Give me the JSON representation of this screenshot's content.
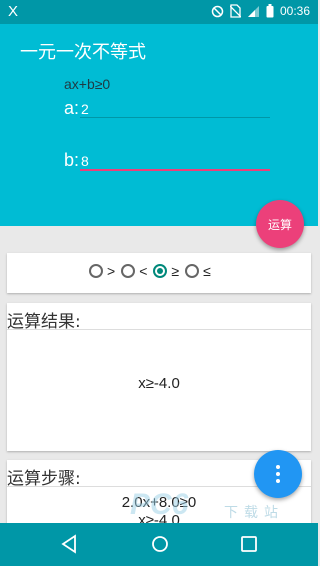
{
  "status_bar": {
    "left_icon_glyph": "X",
    "time": "00:36",
    "icons": [
      "dnd-icon",
      "no-sim-icon",
      "signal-icon",
      "battery-icon"
    ]
  },
  "header": {
    "title": "一元一次不等式",
    "formula": "ax+b≥0",
    "field_a": {
      "label": "a:",
      "value": "2"
    },
    "field_b": {
      "label": "b:",
      "value": "8"
    },
    "calc_button": "运算"
  },
  "radio_group": {
    "options": [
      {
        "symbol": ">",
        "checked": false
      },
      {
        "symbol": "<",
        "checked": false
      },
      {
        "symbol": "≥",
        "checked": true
      },
      {
        "symbol": "≤",
        "checked": false
      }
    ]
  },
  "result_card": {
    "title": "运算结果:",
    "result": "x≥-4.0"
  },
  "steps_card": {
    "title": "运算步骤:",
    "lines": [
      "2.0x+8.0≥0",
      "x≥-4.0"
    ]
  },
  "watermark": {
    "logo": "PC6",
    "text": "下载站"
  },
  "colors": {
    "status_bar": "#0097a7",
    "header": "#00bcd4",
    "field_a_underline": "#0097a7",
    "field_b_underline": "#ec407a",
    "calc_fab": "#ec407a",
    "more_fab": "#2196f3",
    "radio_checked": "#00897b"
  }
}
